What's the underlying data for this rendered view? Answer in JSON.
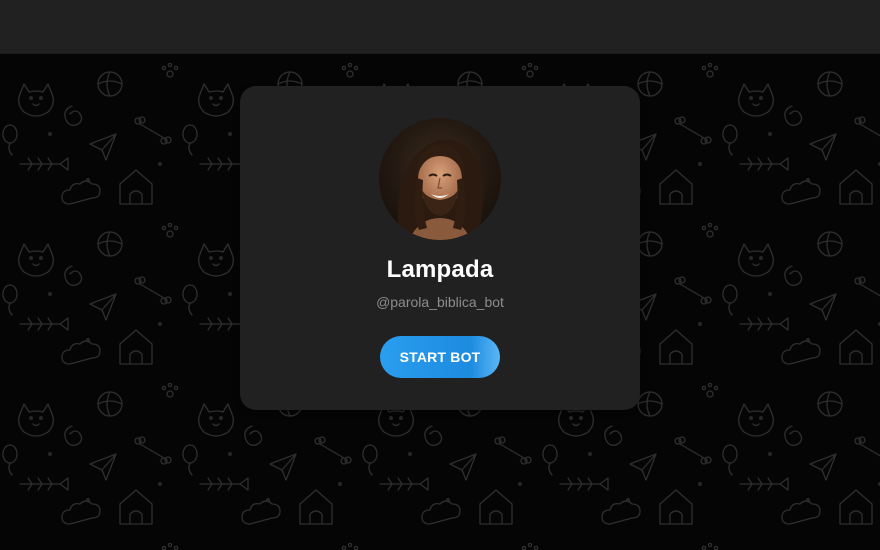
{
  "bot": {
    "name": "Lampada",
    "username": "@parola_biblica_bot",
    "avatar_icon": "bot-profile-photo"
  },
  "actions": {
    "start_label": "START BOT"
  },
  "colors": {
    "background": "#000000",
    "topbar": "#212121",
    "card": "#212121",
    "accent": "#2a9ef0",
    "name_text": "#ffffff",
    "username_text": "#8d8d8d",
    "pattern_stroke": "#2e2e2e"
  }
}
